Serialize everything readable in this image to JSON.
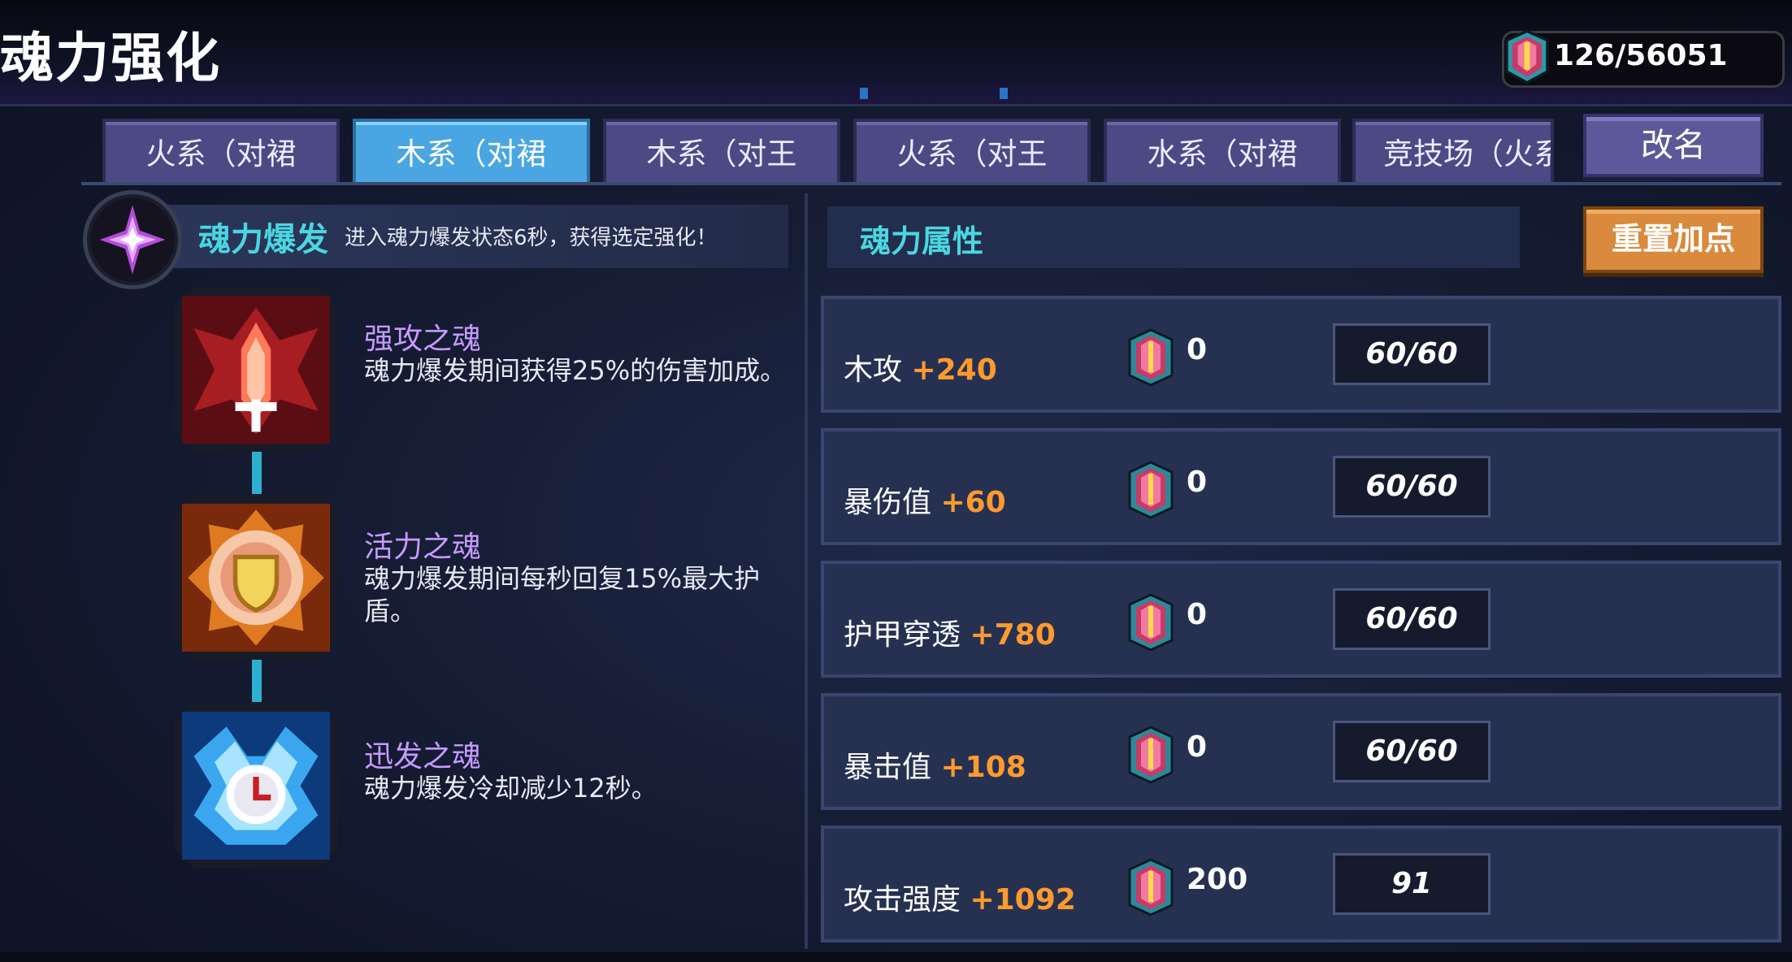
{
  "header": {
    "title": "魂力强化",
    "currency_value": "126/56051"
  },
  "tabs": [
    {
      "label": "火系（对裙",
      "active": false
    },
    {
      "label": "木系（对裙",
      "active": true
    },
    {
      "label": "木系（对王",
      "active": false
    },
    {
      "label": "火系（对王",
      "active": false
    },
    {
      "label": "水系（对裙",
      "active": false
    },
    {
      "label": "竞技场（火系",
      "active": false
    }
  ],
  "rename_label": "改名",
  "burst": {
    "title": "魂力爆发",
    "description": "进入魂力爆发状态6秒，获得选定强化！"
  },
  "skills": [
    {
      "name": "强攻之魂",
      "description": "魂力爆发期间获得25%的伤害加成。"
    },
    {
      "name": "活力之魂",
      "description": "魂力爆发期间每秒回复15%最大护盾。"
    },
    {
      "name": "迅发之魂",
      "description": "魂力爆发冷却减少12秒。"
    }
  ],
  "attributes_panel": {
    "title": "魂力属性",
    "reset_label": "重置加点"
  },
  "attributes": [
    {
      "name": "木攻",
      "bonus": "+240",
      "points": "0",
      "cap": "60/60"
    },
    {
      "name": "暴伤值",
      "bonus": "+60",
      "points": "0",
      "cap": "60/60"
    },
    {
      "name": "护甲穿透",
      "bonus": "+780",
      "points": "0",
      "cap": "60/60"
    },
    {
      "name": "暴击值",
      "bonus": "+108",
      "points": "0",
      "cap": "60/60"
    },
    {
      "name": "攻击强度",
      "bonus": "+1092",
      "points": "200",
      "cap": "91"
    }
  ],
  "colors": {
    "accent_cyan": "#4ad6e0",
    "skill_name_purple": "#c79bff",
    "bonus_orange": "#ff9a2e",
    "active_tab": "#4aa6e2",
    "reset_button": "#d98a3c"
  }
}
